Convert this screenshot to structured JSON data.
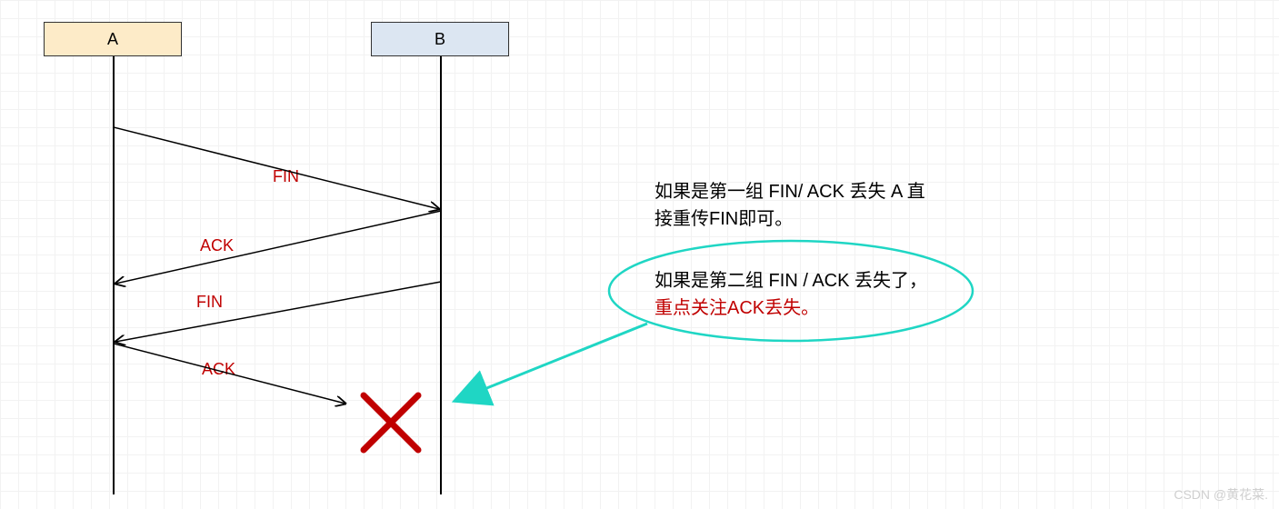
{
  "endpoints": {
    "a": "A",
    "b": "B"
  },
  "messages": {
    "fin1": "FIN",
    "ack1": "ACK",
    "fin2": "FIN",
    "ack2": "ACK"
  },
  "notes": {
    "line1": "如果是第一组 FIN/ ACK 丢失 A 直",
    "line2": "接重传FIN即可。",
    "line3": "如果是第二组 FIN / ACK 丢失了，",
    "line4": "重点关注ACK丢失。"
  },
  "watermark": "CSDN @黄花菜."
}
